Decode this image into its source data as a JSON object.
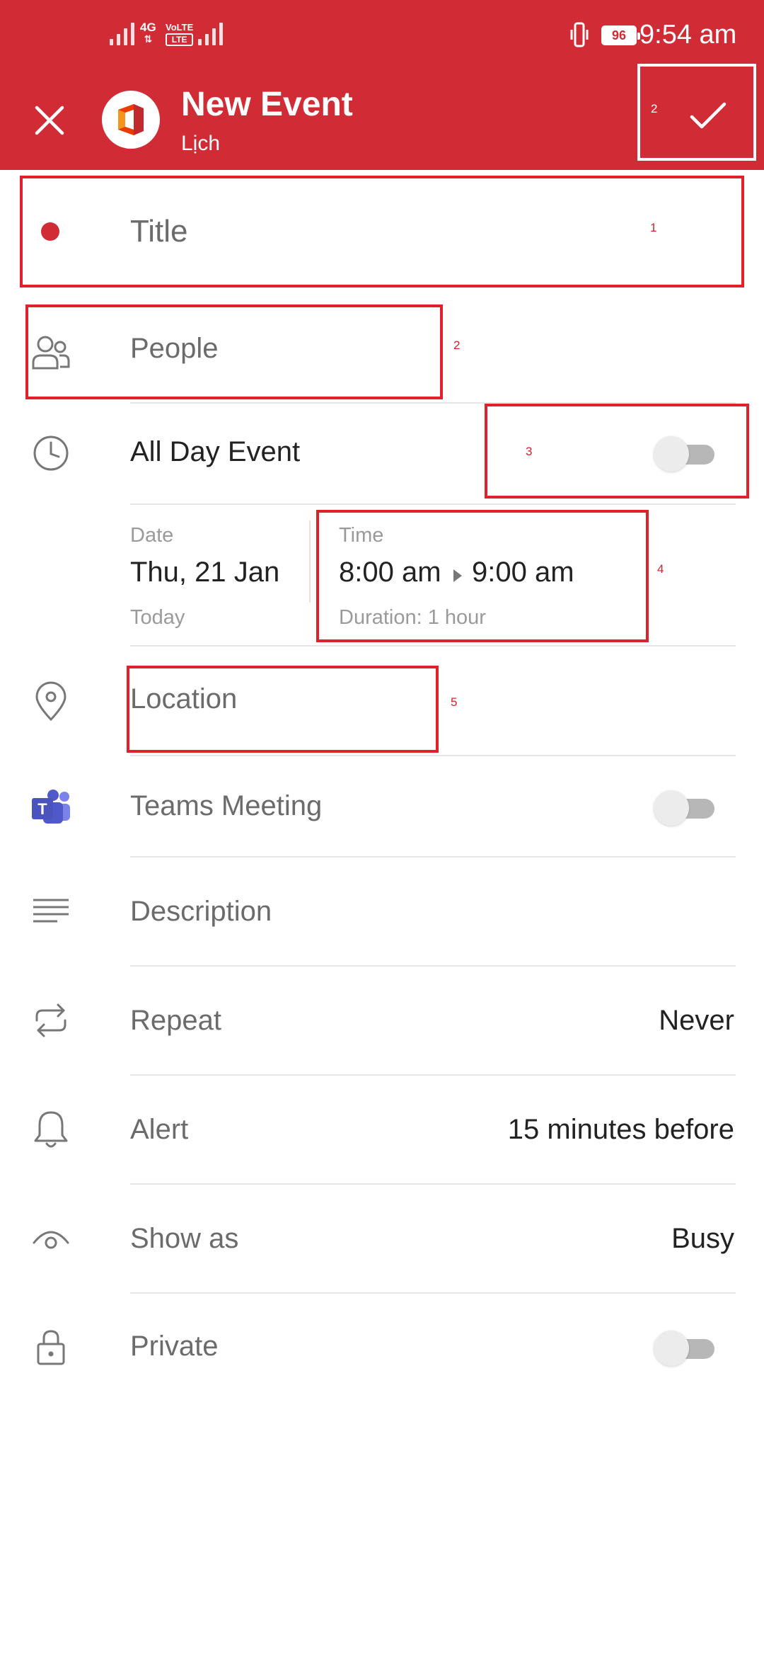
{
  "status_bar": {
    "network_4g": "4G",
    "network_volte": "VoLTE",
    "battery": "96",
    "time": "9:54 am"
  },
  "header": {
    "title": "New Event",
    "subtitle": "Lịch",
    "close_icon": "close-icon",
    "save_icon": "check-icon",
    "background_color": "#d12b36"
  },
  "form": {
    "title_placeholder": "Title",
    "title_dot_color": "#d12b36",
    "people_label": "People",
    "all_day_label": "All Day Event",
    "all_day_on": false,
    "date_label": "Date",
    "date_value": "Thu, 21 Jan",
    "date_sub": "Today",
    "time_label": "Time",
    "time_start": "8:00 am",
    "time_end": "9:00 am",
    "duration": "Duration: 1 hour",
    "location_placeholder": "Location",
    "teams_label": "Teams Meeting",
    "teams_on": false,
    "description_placeholder": "Description",
    "repeat_label": "Repeat",
    "repeat_value": "Never",
    "alert_label": "Alert",
    "alert_value": "15 minutes before",
    "show_as_label": "Show as",
    "show_as_value": "Busy",
    "private_label": "Private",
    "private_on": false
  },
  "annotations": [
    "1",
    "2",
    "2",
    "3",
    "4",
    "5"
  ]
}
